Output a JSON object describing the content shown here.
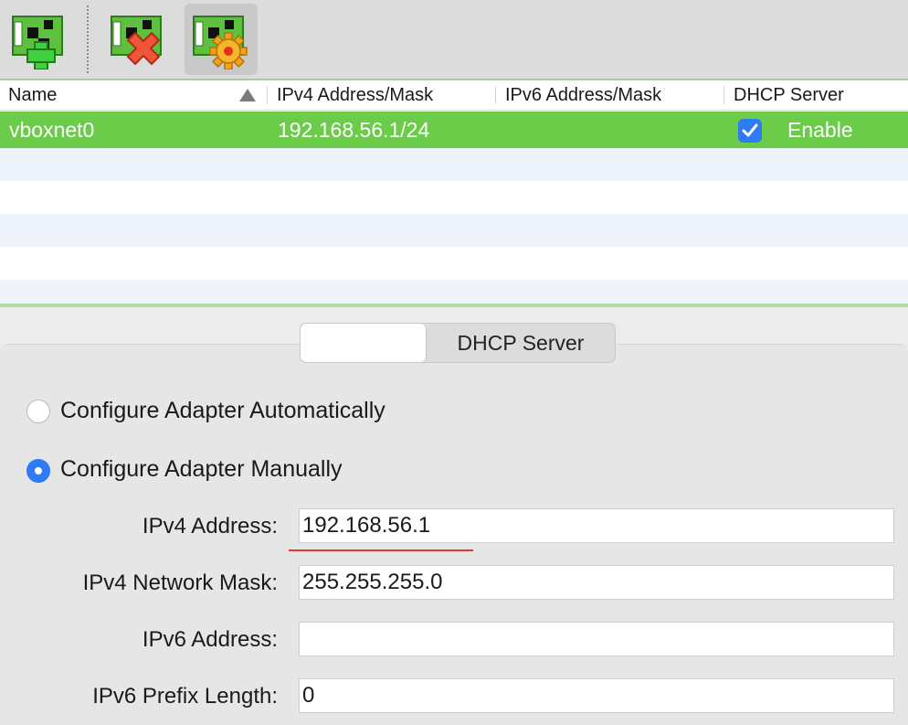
{
  "toolbar": {
    "buttons": [
      {
        "icon": "add-network-icon"
      },
      {
        "icon": "remove-network-icon"
      },
      {
        "icon": "network-properties-icon"
      }
    ]
  },
  "table": {
    "columns": [
      "Name",
      "IPv4 Address/Mask",
      "IPv6 Address/Mask",
      "DHCP Server"
    ],
    "sort_indicator": "ascending",
    "rows": [
      {
        "name": "vboxnet0",
        "ipv4": "192.168.56.1/24",
        "ipv6": "",
        "dhcp_checked": true,
        "dhcp_label": "Enable"
      }
    ]
  },
  "panel": {
    "tabs": [
      {
        "label": "",
        "selected": true
      },
      {
        "label": "DHCP Server",
        "selected": false
      }
    ],
    "radio_auto": {
      "label": "Configure Adapter Automatically",
      "checked": false
    },
    "radio_manual": {
      "label": "Configure Adapter Manually",
      "checked": true
    },
    "fields": {
      "ipv4_address": {
        "label": "IPv4 Address:",
        "value": "192.168.56.1"
      },
      "ipv4_mask": {
        "label": "IPv4 Network Mask:",
        "value": "255.255.255.0"
      },
      "ipv6_address": {
        "label": "IPv6 Address:",
        "value": ""
      },
      "ipv6_prefix": {
        "label": "IPv6 Prefix Length:",
        "value": "0"
      }
    }
  },
  "colors": {
    "selection": "#6bcc4a",
    "accent_blue": "#2f7bf6",
    "annotation_red": "#e23b2e"
  }
}
